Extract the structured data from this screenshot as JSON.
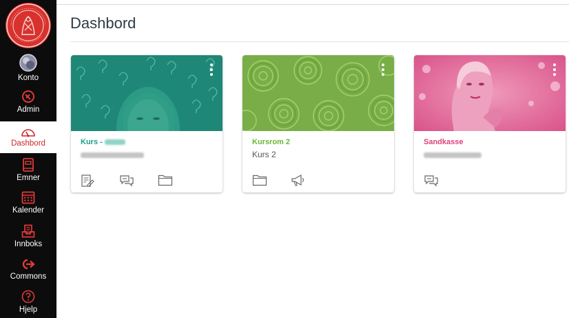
{
  "sidebar": {
    "items": [
      {
        "label": "Konto",
        "icon": "account-avatar-icon"
      },
      {
        "label": "Admin",
        "icon": "shield-icon"
      },
      {
        "label": "Dashbord",
        "icon": "dashboard-gauge-icon",
        "active": true
      },
      {
        "label": "Emner",
        "icon": "book-icon"
      },
      {
        "label": "Kalender",
        "icon": "calendar-icon"
      },
      {
        "label": "Innboks",
        "icon": "inbox-icon"
      },
      {
        "label": "Commons",
        "icon": "commons-arrow-icon"
      },
      {
        "label": "Hjelp",
        "icon": "help-circle-icon"
      }
    ],
    "logo_text": "UNIVERSITAS OSLOENSIS MDCCCXI"
  },
  "main": {
    "title": "Dashbord"
  },
  "cards": [
    {
      "name_prefix": "Kurs -",
      "color": "#1e9e86",
      "code": "",
      "actions": [
        "assignments-icon",
        "discussions-icon",
        "files-icon"
      ]
    },
    {
      "name": "Kursrom 2",
      "color": "#68b832",
      "code": "Kurs 2",
      "actions": [
        "files-icon",
        "announcements-icon"
      ]
    },
    {
      "name": "Sandkasse",
      "color": "#e0417a",
      "code": "",
      "actions": [
        "discussions-icon"
      ]
    }
  ],
  "colors": {
    "sidebar_bg": "#0c0c0c",
    "brand_red": "#c8282c",
    "card1_overlay": "#1e9e86",
    "card2_overlay": "#7fb54a",
    "card3_overlay": "#e26ea0"
  }
}
